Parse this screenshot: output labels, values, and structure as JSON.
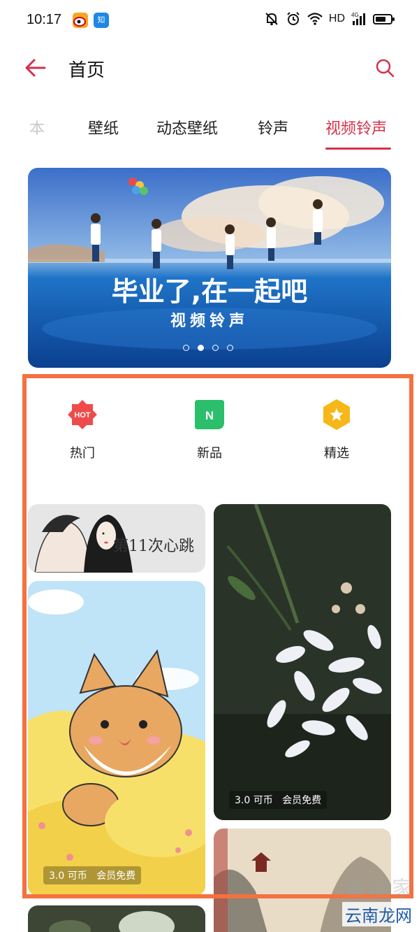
{
  "status_bar": {
    "time": "10:17",
    "app_badges": [
      "weibo-icon",
      "zhihu-icon"
    ],
    "zhihu_label": "知",
    "network": "HD",
    "signal": "4G",
    "battery_level": 0.7,
    "icons": [
      "mute-bell-icon",
      "alarm-icon",
      "wifi-icon",
      "cellular-signal-icon",
      "battery-icon"
    ]
  },
  "header": {
    "title": "首页",
    "back_icon": "arrow-left-icon",
    "search_icon": "search-icon",
    "accent_color": "#d6304b"
  },
  "tabs": [
    {
      "label": "本",
      "state": "partially-visible"
    },
    {
      "label": "壁纸",
      "state": "normal"
    },
    {
      "label": "动态壁纸",
      "state": "normal"
    },
    {
      "label": "铃声",
      "state": "normal"
    },
    {
      "label": "视频铃声",
      "state": "active"
    }
  ],
  "banner": {
    "headline": "毕业了,在一起吧",
    "subtitle": "视频铃声",
    "dots_count": 4,
    "active_dot": 2
  },
  "categories": [
    {
      "label": "热门",
      "icon": "hot-badge-icon",
      "icon_text": "HOT",
      "color": "#ef4b4b"
    },
    {
      "label": "新品",
      "icon": "new-badge-icon",
      "icon_text": "N",
      "color": "#2bbf6b"
    },
    {
      "label": "精选",
      "icon": "star-badge-icon",
      "icon_text": "",
      "color": "#f6b818"
    }
  ],
  "cards": [
    {
      "name": "romance-card",
      "caption": "第11次心跳"
    },
    {
      "name": "flower-card",
      "price": "3.0 可币",
      "member": "会员免费"
    },
    {
      "name": "shiba-card",
      "price": "3.0 可币",
      "member": "会员免费"
    },
    {
      "name": "mountain-card"
    },
    {
      "name": "bottom-left-card"
    }
  ],
  "highlight_color": "#f47140",
  "watermark": {
    "top": "智能家",
    "bottom": "云南龙网"
  }
}
